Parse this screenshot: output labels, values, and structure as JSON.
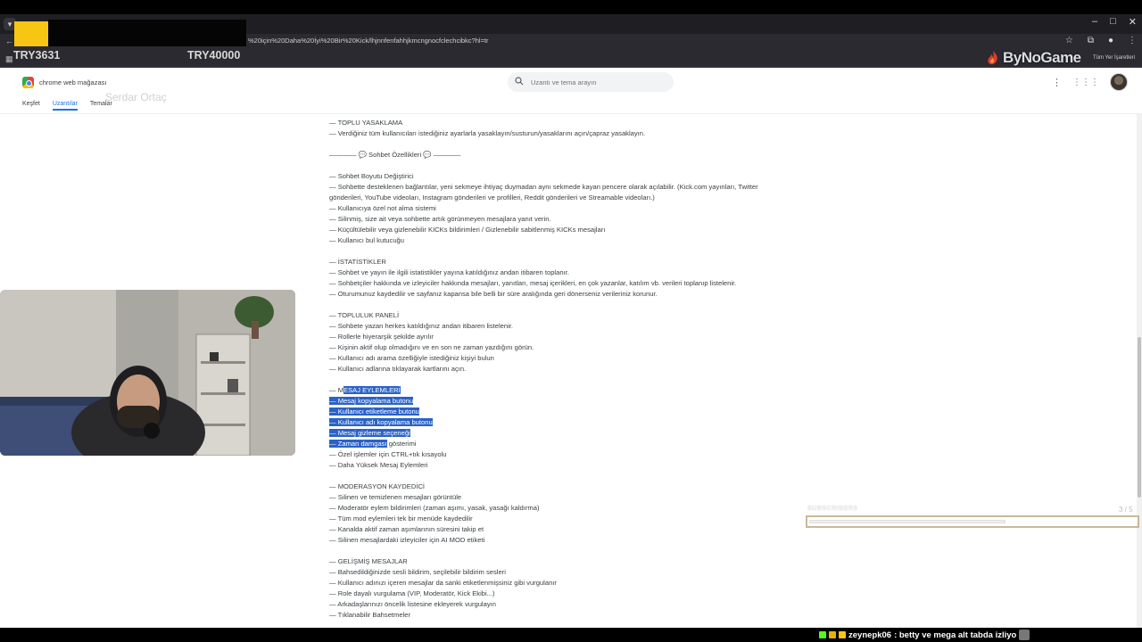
{
  "stream_overlay": {
    "donation_left": "TRY3631",
    "donation_right": "TRY40000",
    "sponsor_logo_text": "ByNoGame",
    "faded_streamer_name": "Serdar Ortaç",
    "colors": {
      "yellow_box": "#f7c614",
      "sponsor_text": "#d9dde6"
    }
  },
  "browser": {
    "url_fragment": "%20için%20Daha%20İyi%20Bir%20Kick/lhjnnfenfahhjkmcngnocfclechcibkc?hl=tr",
    "bookmarks_all_label": "Tüm Yer İşaretleri",
    "window_controls": [
      "–",
      "□",
      "✕"
    ],
    "icons": [
      "star-icon",
      "extensions-icon",
      "profile-icon",
      "menu-dots-icon"
    ]
  },
  "store_header": {
    "title": "chrome web mağazası",
    "search_placeholder": "Uzantı ve tema arayın",
    "nav": [
      {
        "label": "Keşfet",
        "active": false
      },
      {
        "label": "Uzantılar",
        "active": true
      },
      {
        "label": "Temalar",
        "active": false
      }
    ]
  },
  "content": {
    "lines": [
      {
        "text": "— TOPLU YASAKLAMA"
      },
      {
        "text": "   —  Verdiğiniz tüm kullanıcıları istediğiniz ayarlarla yasaklayın/susturun/yasaklarını açın/çapraz yasaklayın."
      },
      {
        "text": ""
      },
      {
        "text": "———— 💬  Sohbet Özellikleri 💬 ————"
      },
      {
        "text": ""
      },
      {
        "text": "— Sohbet Boyutu Değiştirici"
      },
      {
        "text": "— Sohbette desteklenen bağlantılar, yeni sekmeye ihtiyaç duymadan aynı sekmede kayan pencere olarak açılabilir. (Kick.com yayınları, Twitter gönderileri, YouTube videoları, Instagram gönderileri ve profilleri, Reddit gönderileri ve Streamable videoları.)",
        "wrap": true
      },
      {
        "text": "— Kullanıcıya özel not alma sistemi"
      },
      {
        "text": "— Silinmiş, size ait veya sohbette artık görünmeyen mesajlara yanıt verin."
      },
      {
        "text": "— Küçültülebilir veya gizlenebilir KICKs bildirimleri / Gizlenebilir sabitlenmiş KICKs mesajları"
      },
      {
        "text": "— Kullanıcı bul kutucuğu"
      },
      {
        "text": ""
      },
      {
        "text": "— İSTATİSTİKLER"
      },
      {
        "text": "   —  Sohbet ve yayın ile ilgili istatistikler yayına katıldığınız andan itibaren toplanır."
      },
      {
        "text": "   —  Sohbetçiler hakkında ve izleyiciler hakkında mesajları, yanıtları, mesaj içerikleri, en çok yazanlar, katılım vb. verileri toplanıp listelenir."
      },
      {
        "text": "   —  Oturumunuz kaydedilir ve sayfanız kapansa bile belli bir süre aralığında geri dönerseniz verileriniz korunur."
      },
      {
        "text": ""
      },
      {
        "text": "— TOPLULUK PANELİ"
      },
      {
        "text": "   —  Sohbete yazan herkes katıldığınız andan itibaren listelenir."
      },
      {
        "text": "   —  Rollerle hiyerarşik şekilde ayrılır"
      },
      {
        "text": "   —  Kişinin aktif olup olmadığını ve en son ne zaman yazdığını görün."
      },
      {
        "text": "   —  Kullanıcı adı arama özelliğiyle istediğiniz kişiyi bulun"
      },
      {
        "text": "   —  Kullanıcı adlarına tıklayarak kartlarını açın."
      },
      {
        "text": ""
      },
      {
        "pre": "— M",
        "hl": "ESAJ EYLEMLERİ",
        "post": ""
      },
      {
        "pre": "",
        "hl": "   —  Mesaj kopyalama butonu",
        "post": ""
      },
      {
        "pre": "",
        "hl": "   —  Kullanıcı etiketleme butonu",
        "post": ""
      },
      {
        "pre": "",
        "hl": "   —  Kullanıcı adı kopyalama butonu",
        "post": ""
      },
      {
        "pre": "",
        "hl": "   —  Mesaj gizleme seçeneği",
        "post": ""
      },
      {
        "pre": "",
        "hl": "   —  Zaman damgası",
        "post": " gösterimi"
      },
      {
        "text": "   —  Özel işlemler için CTRL+tık kısayolu"
      },
      {
        "text": "   —  Daha Yüksek Mesaj Eylemleri"
      },
      {
        "text": ""
      },
      {
        "text": "— MODERASYON KAYDEDİCİ"
      },
      {
        "text": "   —  Silinen ve temizlenen mesajları görüntüle"
      },
      {
        "text": "   —  Moderatör eylem bildirimleri (zaman aşımı, yasak, yasağı kaldırma)"
      },
      {
        "text": "   —  Tüm mod eylemleri tek bir menüde kaydedilir"
      },
      {
        "text": "   —  Kanalda aktif zaman aşımlarının süresini takip et"
      },
      {
        "text": "   —  Silinen mesajlardaki izleyiciler için AI MOD etiketi"
      },
      {
        "text": ""
      },
      {
        "text": "— GELİŞMİŞ MESAJLAR"
      },
      {
        "text": "   —  Bahsedildiğinizde sesli bildirim, seçilebilir bildirim sesleri"
      },
      {
        "text": "   —  Kullanıcı adınızı içeren mesajlar da sanki etiketlenmişsiniz gibi vurgulanır"
      },
      {
        "text": "   —  Role dayalı vurgulama (VIP, Moderatör, Kick Ekibi...)"
      },
      {
        "text": "   —  Arkadaşlarınızı öncelik listesine ekleyerek vurgulayın"
      },
      {
        "text": "   —  Tıklanabilir Bahsetmeler"
      }
    ]
  },
  "subscriber_goal": {
    "label": "SUBSCRIBERS",
    "count_text": "3 / 5",
    "progress": 0.6
  },
  "chat_ticker": {
    "username": "zeynepk06",
    "message": ": betty ve mega alt tabda izliyo"
  }
}
